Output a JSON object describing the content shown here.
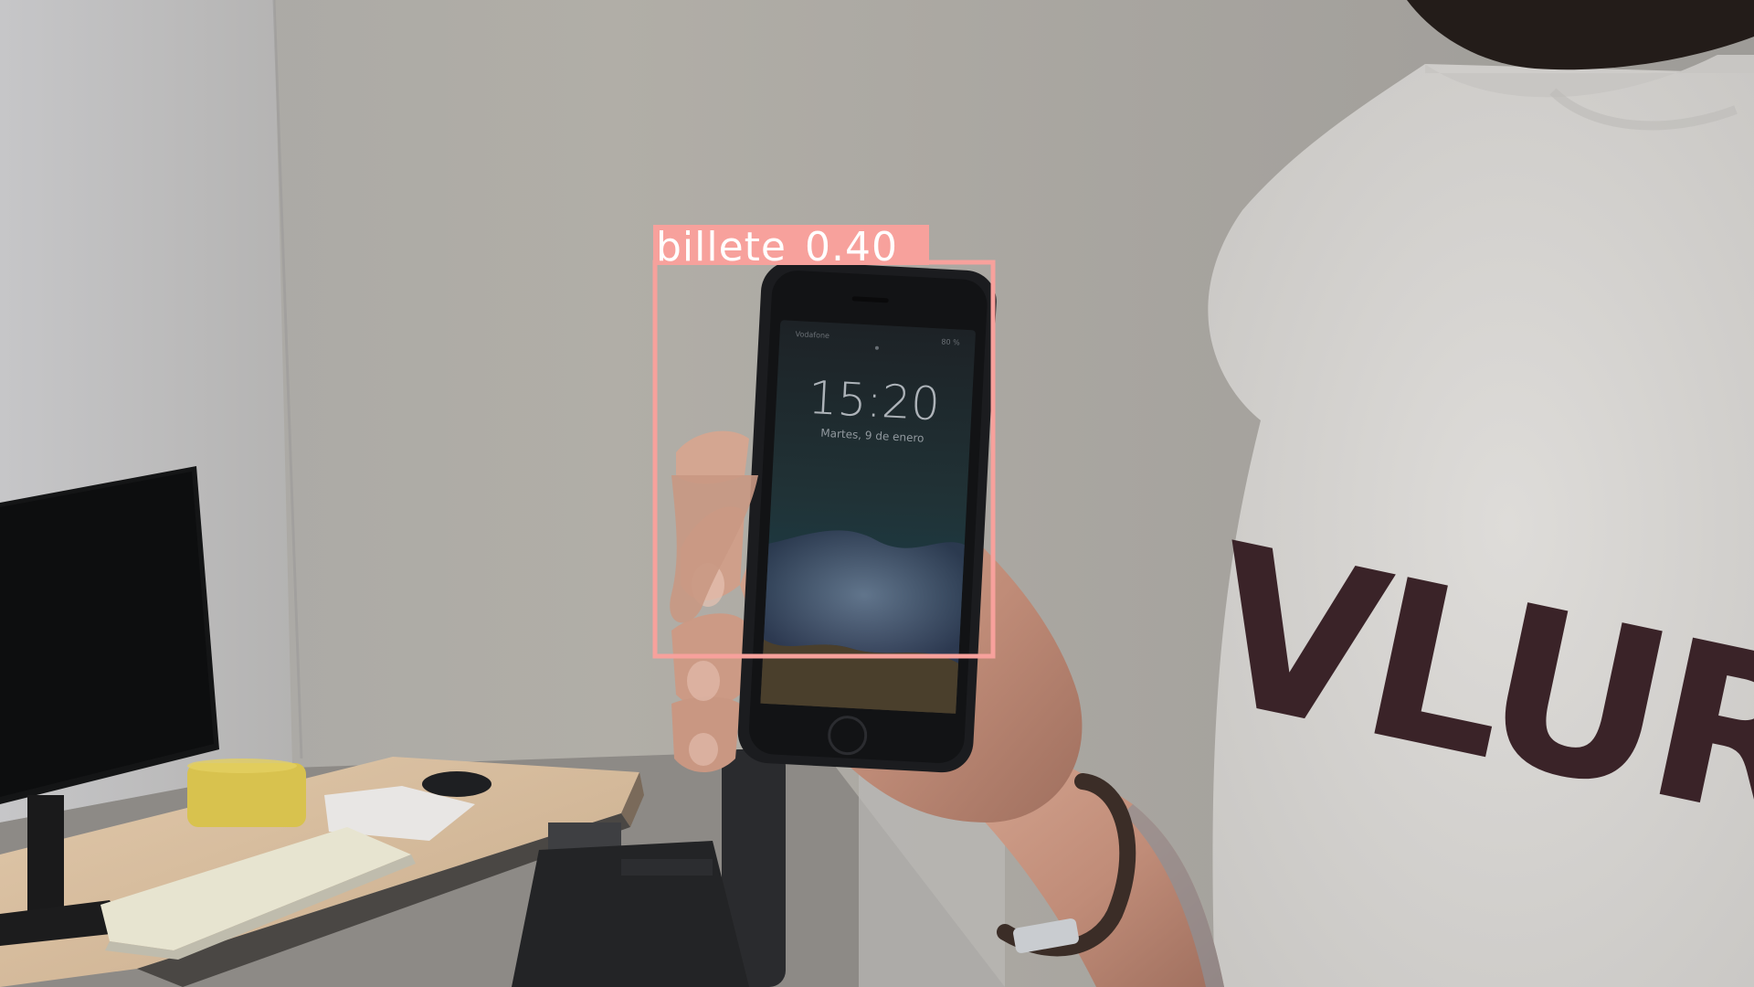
{
  "detection": {
    "label": "billete",
    "score": "0.40",
    "box_color": "#f7a19c",
    "text_color": "#ffffff"
  },
  "phone_screen": {
    "time": "15:20",
    "date": "Martes, 9 de enero",
    "carrier": "Vodafone",
    "battery": "80 %"
  },
  "sweater_print": "VLUR",
  "colors": {
    "wall": "#a9a59f",
    "sweater": "#d9d9d7",
    "desk": "#d8bfa0",
    "phone_body": "#1b1c1f",
    "skin": "#c89a86"
  }
}
